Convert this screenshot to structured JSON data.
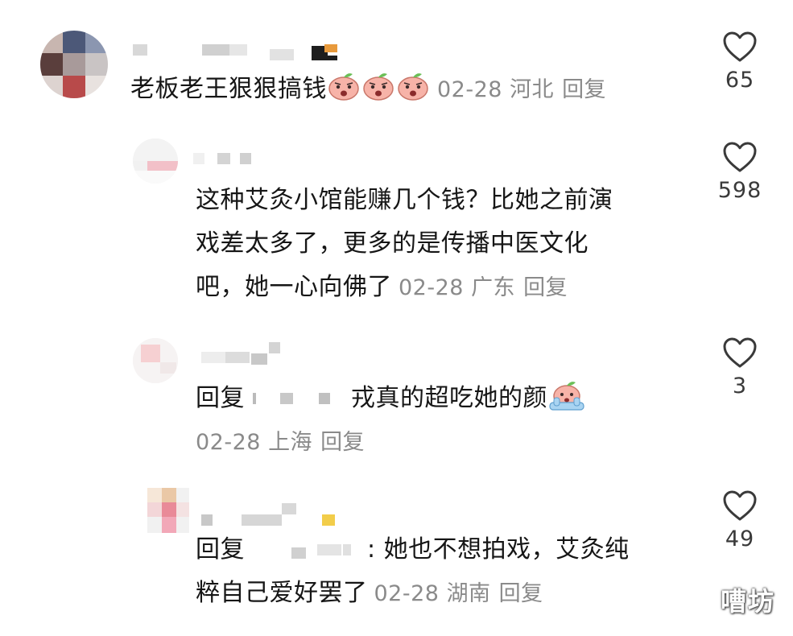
{
  "comments": [
    {
      "text": "老板老王狠狠搞钱",
      "emoji_count": 3,
      "date": "02-28",
      "location": "河北",
      "reply_label": "回复",
      "likes": "65"
    },
    {
      "text_line1": "这种艾灸小馆能赚几个钱？比她之前演",
      "text_line2": "戏差太多了，更多的是传播中医文化",
      "text_line3": "吧，她一心向佛了",
      "date": "02-28",
      "location": "广东",
      "reply_label": "回复",
      "likes": "598"
    },
    {
      "reply_prefix": "回复",
      "text": "戎真的超吃她的颜",
      "date": "02-28",
      "location": "上海",
      "reply_label": "回复",
      "likes": "3"
    },
    {
      "reply_prefix": "回复",
      "text_line1": ": 她也不想拍戏，艾灸纯",
      "text_line2": "粹自己爱好罢了",
      "date": "02-28",
      "location": "湖南",
      "reply_label": "回复",
      "likes": "49"
    }
  ],
  "icons": {
    "like": "heart-outline-icon",
    "emoji": "peach-face-emoji"
  },
  "colors": {
    "text": "#161616",
    "meta": "#8a8a8a",
    "count": "#3a3a3a",
    "emoji_body": "#f7b3a8",
    "emoji_leaf": "#6bbf57"
  },
  "watermark": "嘈坊"
}
